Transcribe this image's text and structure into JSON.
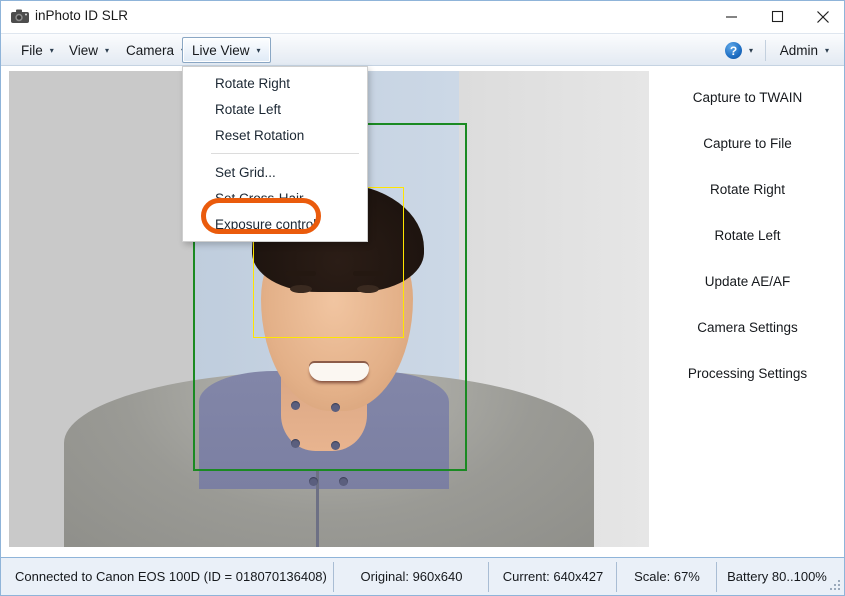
{
  "window": {
    "title": "inPhoto ID SLR",
    "icon": "camera-icon",
    "minimize_label": "─",
    "maximize_label": "□",
    "close_label": "✕"
  },
  "menubar": {
    "items": [
      {
        "label": "File",
        "caret": "▾"
      },
      {
        "label": "View",
        "caret": "▾"
      },
      {
        "label": "Camera",
        "caret": "▾"
      },
      {
        "label": "Live View",
        "caret": "▾"
      }
    ],
    "help": {
      "glyph": "?",
      "caret": "▾"
    },
    "admin": {
      "label": "Admin",
      "caret": "▾"
    }
  },
  "dropdown": {
    "owner": "Live View",
    "items": [
      {
        "label": "Rotate Right",
        "separator_after": false
      },
      {
        "label": "Rotate Left",
        "separator_after": false
      },
      {
        "label": "Reset Rotation",
        "separator_after": true
      },
      {
        "label": "Set Grid...",
        "separator_after": false
      },
      {
        "label": "Set Cross-Hair...",
        "separator_after": false
      },
      {
        "label": "Exposure control",
        "separator_after": false
      }
    ],
    "highlighted_item": "Exposure control",
    "highlight_color": "#ea5b0c"
  },
  "actions": [
    {
      "label": "Capture to TWAIN"
    },
    {
      "label": "Capture to File"
    },
    {
      "label": "Rotate Right"
    },
    {
      "label": "Rotate Left"
    },
    {
      "label": "Update AE/AF"
    },
    {
      "label": "Camera Settings"
    },
    {
      "label": "Processing Settings"
    }
  ],
  "preview": {
    "document_frame_color": "#1a8a22",
    "face_frame_color": "#ffe500"
  },
  "statusbar": {
    "connection": "Connected to Canon EOS 100D (ID = 018070136408)",
    "original": "Original: 960x640",
    "current": "Current: 640x427",
    "scale": "Scale: 67%",
    "battery": "Battery 80..100%"
  }
}
